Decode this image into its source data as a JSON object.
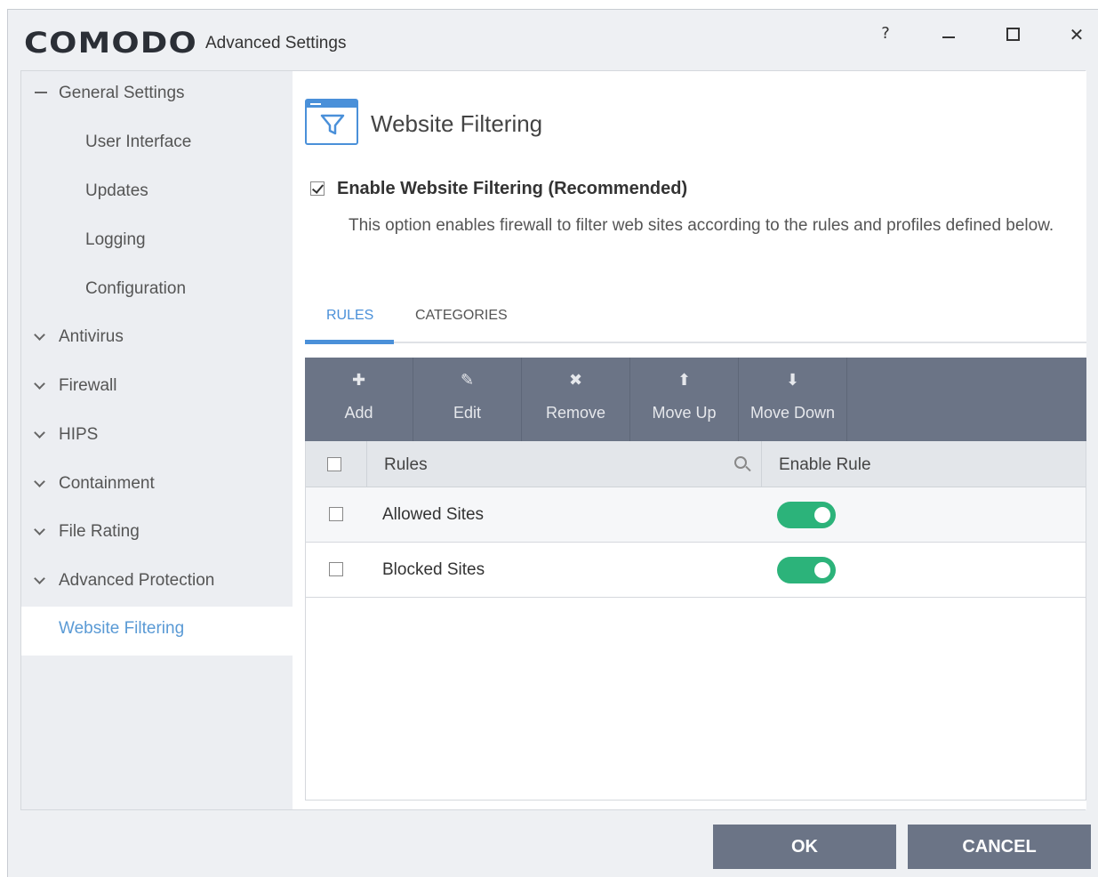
{
  "window": {
    "logo_text": "COMODO",
    "title": "Advanced Settings",
    "controls": {
      "help": "?",
      "close": "✕"
    }
  },
  "sidebar": {
    "items": [
      {
        "label": "General Settings",
        "level": "top",
        "icon": "minus-icon"
      },
      {
        "label": "User Interface",
        "level": "sub"
      },
      {
        "label": "Updates",
        "level": "sub"
      },
      {
        "label": "Logging",
        "level": "sub"
      },
      {
        "label": "Configuration",
        "level": "sub"
      },
      {
        "label": "Antivirus",
        "level": "top",
        "icon": "chevron-down-icon"
      },
      {
        "label": "Firewall",
        "level": "top",
        "icon": "chevron-down-icon"
      },
      {
        "label": "HIPS",
        "level": "top",
        "icon": "chevron-down-icon"
      },
      {
        "label": "Containment",
        "level": "top",
        "icon": "chevron-down-icon"
      },
      {
        "label": "File Rating",
        "level": "top",
        "icon": "chevron-down-icon"
      },
      {
        "label": "Advanced Protection",
        "level": "top",
        "icon": "chevron-down-icon"
      },
      {
        "label": "Website Filtering",
        "level": "top",
        "active": true
      }
    ]
  },
  "main": {
    "title": "Website Filtering",
    "enable": {
      "label": "Enable Website Filtering (Recommended)",
      "checked": true,
      "description": "This option enables firewall to filter web sites according to the rules and profiles defined below."
    },
    "tabs": [
      {
        "label": "RULES",
        "active": true
      },
      {
        "label": "CATEGORIES",
        "active": false
      }
    ],
    "toolbar": [
      {
        "label": "Add",
        "icon": "plus-icon",
        "glyph": "✚"
      },
      {
        "label": "Edit",
        "icon": "pencil-icon",
        "glyph": "✎"
      },
      {
        "label": "Remove",
        "icon": "x-icon",
        "glyph": "✖"
      },
      {
        "label": "Move Up",
        "icon": "arrow-up-icon",
        "glyph": "⬆"
      },
      {
        "label": "Move Down",
        "icon": "arrow-down-icon",
        "glyph": "⬇"
      }
    ],
    "table": {
      "columns": [
        "Rules",
        "Enable Rule"
      ],
      "rows": [
        {
          "name": "Allowed Sites",
          "enabled": true
        },
        {
          "name": "Blocked Sites",
          "enabled": true
        }
      ]
    }
  },
  "footer": {
    "ok_label": "OK",
    "cancel_label": "CANCEL"
  },
  "colors": {
    "accent": "#4a90d9",
    "toolbar_bg": "#6b7486",
    "toggle_on": "#2cb37a",
    "active_nav_text": "#5a9ad5"
  }
}
